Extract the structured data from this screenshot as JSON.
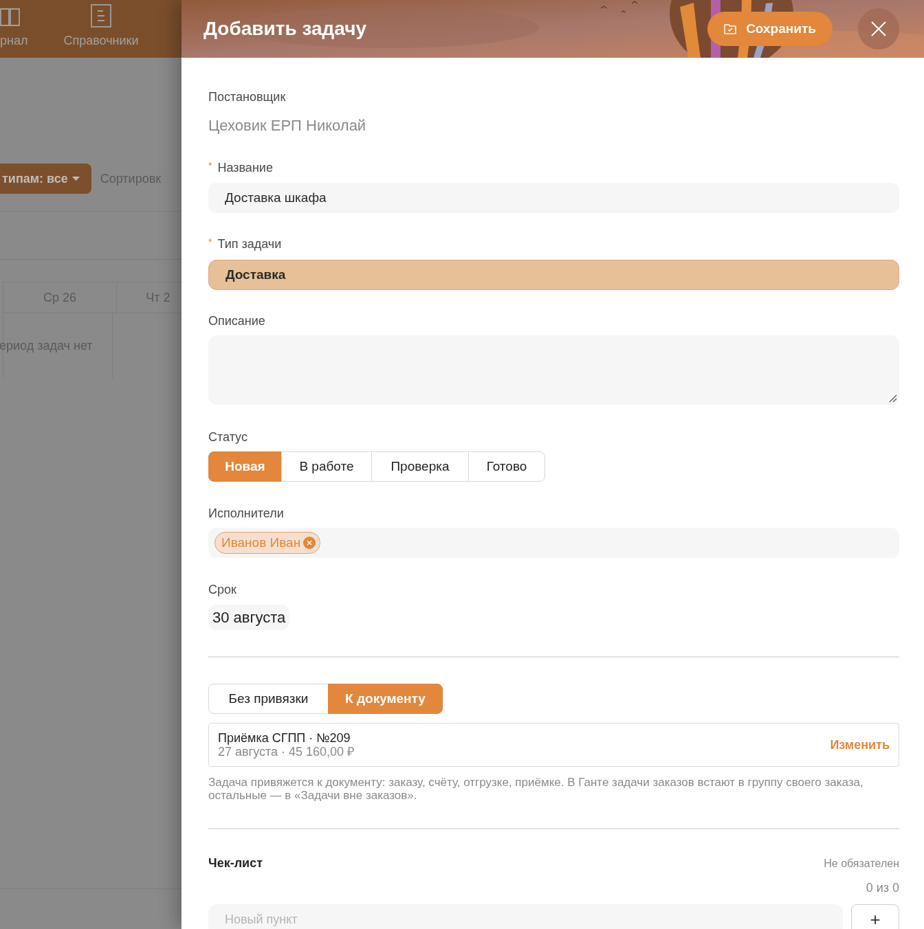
{
  "background": {
    "nav": [
      {
        "kind": "book",
        "label": "рнал"
      },
      {
        "kind": "document",
        "label": "Справочники"
      }
    ],
    "filter_button": "типам: все",
    "sort_label": "Сортировк",
    "calendar_columns": [
      "Ср 26",
      "Чт 2"
    ],
    "empty_message": "ериод задач нет"
  },
  "panel": {
    "title": "Добавить задачу",
    "save_button": "Сохранить"
  },
  "assigner": {
    "label": "Постановщик",
    "value": "Цеховик ЕРП Николай"
  },
  "name": {
    "label": "Название",
    "required_mark": "*",
    "value": "Доставка шкафа"
  },
  "task_type": {
    "label": "Тип задачи",
    "required_mark": "*",
    "value": "Доставка"
  },
  "description": {
    "label": "Описание"
  },
  "status": {
    "label": "Статус",
    "options": [
      {
        "label": "Новая",
        "selected": true
      },
      {
        "label": "В работе",
        "selected": false
      },
      {
        "label": "Проверка",
        "selected": false
      },
      {
        "label": "Готово",
        "selected": false
      }
    ]
  },
  "assignees": {
    "label": "Исполнители",
    "tags": [
      "Иванов Иван"
    ]
  },
  "deadline": {
    "label": "Срок",
    "value": "30 августа"
  },
  "binding": {
    "options": [
      {
        "label": "Без привязки",
        "selected": false
      },
      {
        "label": "К документу",
        "selected": true
      }
    ]
  },
  "document": {
    "title": "Приёмка СГПП · №209",
    "subtitle": "27 августа · 45 160,00 ₽",
    "change_link": "Изменить"
  },
  "binding_hint": "Задача привяжется к документу: заказу, счёту, отгрузке, приёмке. В Ганте задачи заказов встают в группу своего заказа, остальные — в «Задачи вне заказов».",
  "checklist": {
    "title": "Чек-лист",
    "note": "Не обязателен",
    "counter": "0 из 0",
    "new_item_placeholder": "Новый пункт",
    "add_button": "+"
  }
}
